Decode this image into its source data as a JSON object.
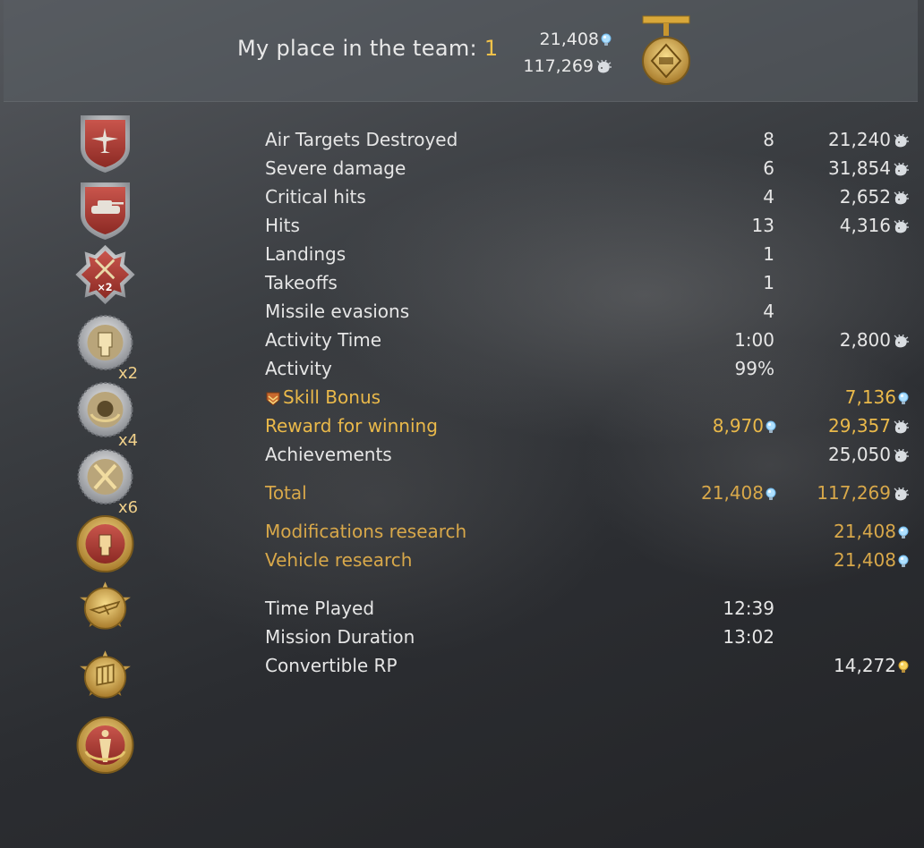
{
  "header": {
    "place_label": "My place in the team:",
    "place_value": "1",
    "rp_total": "21,408",
    "sl_total": "117,269"
  },
  "award_multipliers": [
    "x2",
    "x4",
    "x6"
  ],
  "award_badge_text": "×2",
  "rows": [
    {
      "label": "Air Targets Destroyed",
      "count": "8",
      "value": "21,240",
      "value_icon": "silver-lion-icon"
    },
    {
      "label": "Severe damage",
      "count": "6",
      "value": "31,854",
      "value_icon": "silver-lion-icon"
    },
    {
      "label": "Critical hits",
      "count": "4",
      "value": "2,652",
      "value_icon": "silver-lion-icon"
    },
    {
      "label": "Hits",
      "count": "13",
      "value": "4,316",
      "value_icon": "silver-lion-icon"
    },
    {
      "label": "Landings",
      "count": "1",
      "value": ""
    },
    {
      "label": "Takeoffs",
      "count": "1",
      "value": ""
    },
    {
      "label": "Missile evasions",
      "count": "4",
      "value": ""
    },
    {
      "label": "Activity Time",
      "count": "1:00",
      "value": "2,800",
      "value_icon": "silver-lion-icon"
    },
    {
      "label": "Activity",
      "count": "99%",
      "value": ""
    },
    {
      "label": "Skill Bonus",
      "count": "",
      "value": "7,136",
      "value_icon": "research-point-icon"
    },
    {
      "label": "Reward for winning",
      "count": "8,970",
      "value": "29,357",
      "value_icon": "silver-lion-icon"
    },
    {
      "label": "Achievements",
      "count": "",
      "value": "25,050",
      "value_icon": "silver-lion-icon"
    },
    {
      "label": "Total",
      "count": "21,408",
      "value": "117,269",
      "value_icon": "silver-lion-icon"
    },
    {
      "label": "Modifications research",
      "count": "",
      "value": "21,408",
      "value_icon": "research-point-icon"
    },
    {
      "label": "Vehicle research",
      "count": "",
      "value": "21,408",
      "value_icon": "research-point-icon"
    },
    {
      "label": "Time Played",
      "count": "12:39",
      "value": ""
    },
    {
      "label": "Mission Duration",
      "count": "13:02",
      "value": ""
    },
    {
      "label": "Convertible RP",
      "count": "",
      "value": "14,272",
      "value_icon": "convertible-rp-icon"
    }
  ],
  "colors": {
    "gold_text": "#eab94a",
    "place_number": "#f2c24a",
    "rp_icon": "#8fd0ff",
    "convertible_rp_icon": "#f5c94a"
  }
}
